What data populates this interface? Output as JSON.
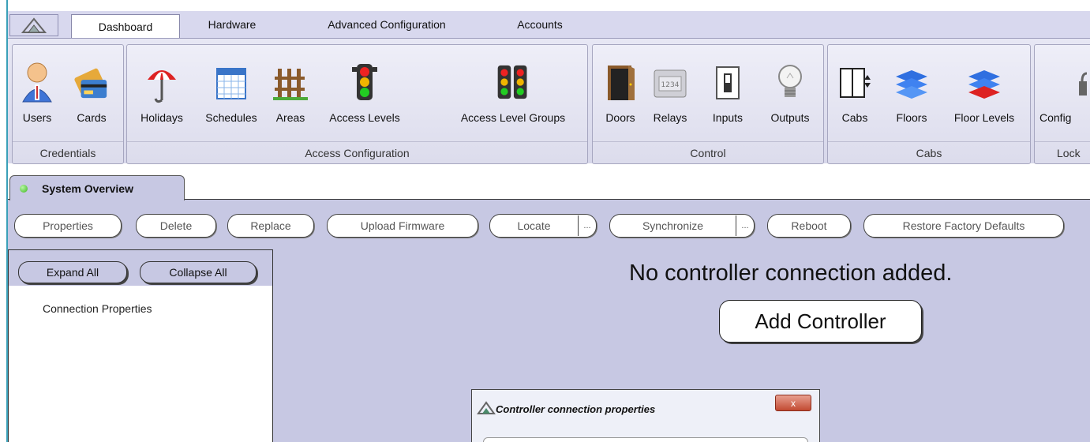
{
  "tabs": [
    "Dashboard",
    "Hardware",
    "Advanced Configuration",
    "Accounts"
  ],
  "ribbon": {
    "credentials": {
      "label": "Credentials",
      "items": [
        "Users",
        "Cards"
      ]
    },
    "access": {
      "label": "Access Configuration",
      "items": [
        "Holidays",
        "Schedules",
        "Areas",
        "Access Levels",
        "Access Level Groups"
      ]
    },
    "control": {
      "label": "Control",
      "items": [
        "Doors",
        "Relays",
        "Inputs",
        "Outputs"
      ]
    },
    "cabs": {
      "label": "Cabs",
      "items": [
        "Cabs",
        "Floors",
        "Floor Levels"
      ]
    },
    "lock": {
      "label": "Lock",
      "items": [
        "Config"
      ]
    }
  },
  "doc_tab": {
    "title": "System Overview",
    "status_color": "#3db61f"
  },
  "toolbar": {
    "properties": "Properties",
    "delete": "Delete",
    "replace": "Replace",
    "upload_firmware": "Upload Firmware",
    "locate": "Locate",
    "more": "...",
    "synchronize": "Synchronize",
    "reboot": "Reboot",
    "restore": "Restore Factory Defaults"
  },
  "left_panel": {
    "expand_all": "Expand All",
    "collapse_all": "Collapse All",
    "tree_item": "Connection Properties"
  },
  "main": {
    "empty_message": "No controller connection added.",
    "add_controller": "Add Controller"
  },
  "dialog": {
    "title": "Controller connection properties",
    "close": "x"
  }
}
